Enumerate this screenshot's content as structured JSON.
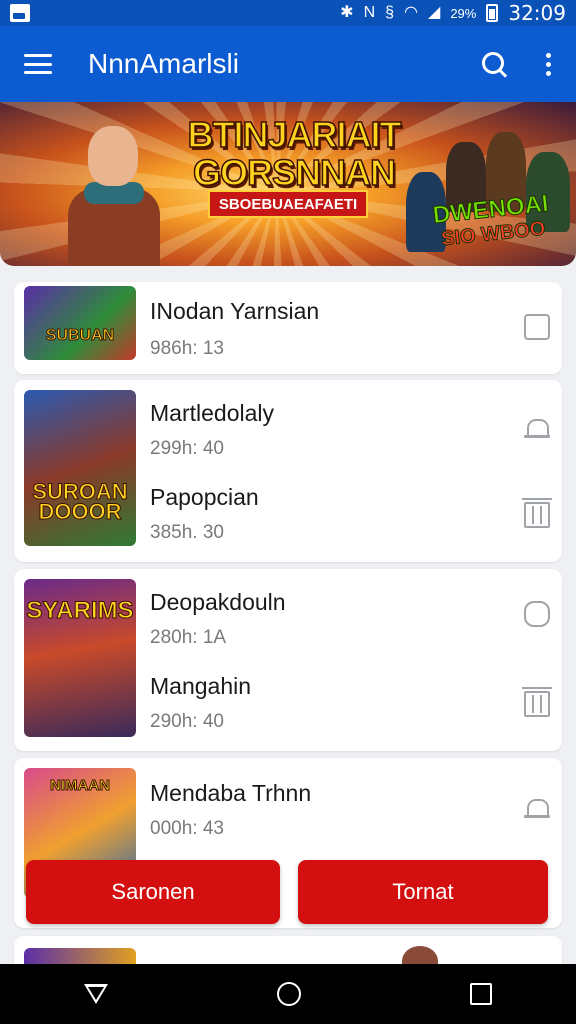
{
  "status_bar": {
    "time": "32:09",
    "battery_text": "29%",
    "icons": [
      "image-notification-icon",
      "bluetooth-icon",
      "mute-icon",
      "nfc-icon",
      "wifi-icon",
      "signal-icon",
      "battery-icon"
    ]
  },
  "app_bar": {
    "title": "NnnAmarlsli",
    "icons": [
      "menu-icon",
      "search-icon",
      "more-vert-icon"
    ]
  },
  "banner": {
    "title": "BTINJARIAIT GORSNNAN",
    "ribbon": "SBOEBUAEAFAETI",
    "badge_line1": "DWENOAI",
    "badge_line2": "SIO WBOO"
  },
  "list": {
    "items": [
      {
        "title": "INodan Yarnsian",
        "meta": "986h: 13",
        "thumb_text": "SUBUAN",
        "action_icon": "square-icon"
      },
      {
        "title": "Martledolaly",
        "meta": "299h: 40",
        "thumb_text": "SUROAN DOOOR",
        "action_icon": "bell-icon"
      },
      {
        "title": "Papopcian",
        "meta": "385h. 30",
        "action_icon": "trash-icon"
      },
      {
        "title": "Deopakdouln",
        "meta": "280h: 1A",
        "thumb_text": "SYARIMS",
        "action_icon": "lock-icon"
      },
      {
        "title": "Mangahin",
        "meta": "290h: 40",
        "action_icon": "trash-icon"
      },
      {
        "title": "Mendaba  Trhnn",
        "meta": "000h: 43",
        "thumb_text": "NIMAAN",
        "action_icon": "bell-icon"
      }
    ]
  },
  "buttons": {
    "left_label": "Saronen",
    "right_label": "Tornat"
  },
  "colors": {
    "primary": "#0d5bd0",
    "status_bar": "#0b52b8",
    "accent_red": "#d40f0f",
    "background": "#eef0f3"
  }
}
